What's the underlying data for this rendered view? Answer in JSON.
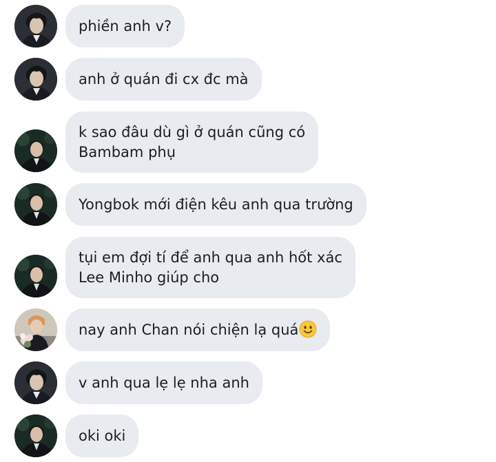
{
  "messages": [
    {
      "lines": [
        "phiền anh v?"
      ],
      "avatar": "member-a"
    },
    {
      "lines": [
        "anh ở quán đi cx đc mà"
      ],
      "avatar": "member-a"
    },
    {
      "lines": [
        "k sao đâu dù gì ở quán cũng có",
        "Bambam phụ"
      ],
      "avatar": "member-b"
    },
    {
      "lines": [
        "Yongbok mới điện kêu anh qua trường"
      ],
      "avatar": "member-b"
    },
    {
      "lines": [
        "tụi em đợi tí để anh qua anh hốt xác",
        "Lee Minho giúp cho"
      ],
      "avatar": "member-b"
    },
    {
      "lines": [
        "nay anh Chan nói chiện lạ quá"
      ],
      "avatar": "member-c",
      "emoji": "slightly-smiling-face"
    },
    {
      "lines": [
        "v anh qua lẹ lẹ nha anh"
      ],
      "avatar": "member-a"
    },
    {
      "lines": [
        "oki oki"
      ],
      "avatar": "member-b"
    }
  ],
  "colors": {
    "bubble": "#e8ebef",
    "text": "#1c1e21",
    "background": "#ffffff"
  }
}
